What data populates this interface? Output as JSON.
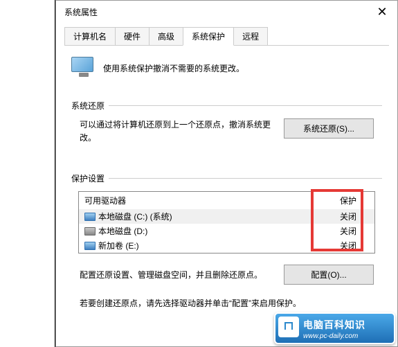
{
  "window": {
    "title": "系统属性"
  },
  "tabs": [
    {
      "label": "计算机名"
    },
    {
      "label": "硬件"
    },
    {
      "label": "高级"
    },
    {
      "label": "系统保护",
      "active": true
    },
    {
      "label": "远程"
    }
  ],
  "intro_text": "使用系统保护撤消不需要的系统更改。",
  "restore_section": {
    "title": "系统还原",
    "description": "可以通过将计算机还原到上一个还原点，撤消系统更改。",
    "button": "系统还原(S)..."
  },
  "protection_section": {
    "title": "保护设置",
    "header_drives": "可用驱动器",
    "header_protection": "保护",
    "drives": [
      {
        "name": "本地磁盘 (C:) (系统)",
        "status": "关闭",
        "icon": "blue",
        "selected": true
      },
      {
        "name": "本地磁盘 (D:)",
        "status": "关闭",
        "icon": "gray"
      },
      {
        "name": "新加卷 (E:)",
        "status": "关闭",
        "icon": "blue"
      }
    ],
    "config_text": "配置还原设置、管理磁盘空间，并且删除还原点。",
    "config_button": "配置(O)...",
    "bottom_text": "若要创建还原点，请先选择驱动器并单击“配置”来启用保护。"
  },
  "watermark": {
    "title": "电脑百科知识",
    "url": "www.pc-daily.com"
  }
}
